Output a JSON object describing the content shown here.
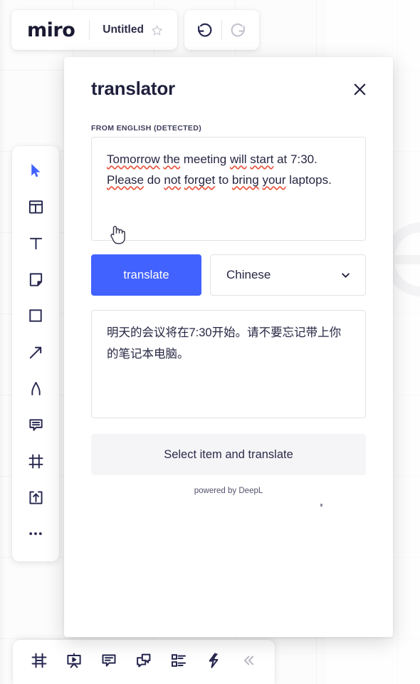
{
  "app": {
    "logo": "miro",
    "document_title": "Untitled",
    "star_icon": "star-icon",
    "undo_icon": "undo-arrow-icon",
    "redo_icon": "redo-arrow-icon"
  },
  "left_toolbar": {
    "items": [
      {
        "name": "select-cursor",
        "label": "Select",
        "icon": "cursor-arrow-icon",
        "active": true
      },
      {
        "name": "templates",
        "label": "Templates",
        "icon": "template-grid-icon",
        "active": false
      },
      {
        "name": "text",
        "label": "Text",
        "icon": "text-t-icon",
        "active": false
      },
      {
        "name": "sticky-note",
        "label": "Sticky note",
        "icon": "sticky-note-icon",
        "active": false
      },
      {
        "name": "shapes",
        "label": "Shapes",
        "icon": "square-shape-icon",
        "active": false
      },
      {
        "name": "connection-line",
        "label": "Connection line",
        "icon": "arrow-diagonal-icon",
        "active": false
      },
      {
        "name": "pen",
        "label": "Pen",
        "icon": "pen-compass-icon",
        "active": false
      },
      {
        "name": "comment",
        "label": "Comment",
        "icon": "comment-bubble-icon",
        "active": false
      },
      {
        "name": "frame",
        "label": "Frame",
        "icon": "frame-icon",
        "active": false
      },
      {
        "name": "upload",
        "label": "Upload",
        "icon": "upload-box-icon",
        "active": false
      },
      {
        "name": "more-apps",
        "label": "More apps",
        "icon": "ellipsis-icon",
        "active": false
      }
    ]
  },
  "bottom_toolbar": {
    "items": [
      {
        "name": "frames-panel",
        "label": "Frames",
        "icon": "frame-icon"
      },
      {
        "name": "presentation",
        "label": "Presentation mode",
        "icon": "presentation-play-icon"
      },
      {
        "name": "comments",
        "label": "Comments",
        "icon": "comment-lines-icon"
      },
      {
        "name": "chat",
        "label": "Chat",
        "icon": "chat-bubbles-icon"
      },
      {
        "name": "cards",
        "label": "Cards",
        "icon": "list-cards-icon"
      },
      {
        "name": "apps",
        "label": "Apps",
        "icon": "lightning-bolt-icon"
      },
      {
        "name": "collapse",
        "label": "Collapse",
        "icon": "double-chevron-left-icon"
      }
    ]
  },
  "panel": {
    "title": "translator",
    "close_icon": "close-x-icon",
    "source_label": "FROM ENGLISH (DETECTED)",
    "source_text": "Tomorrow the meeting will start at 7:30. Please do not forget to bring your laptops.",
    "source_spellcheck_words": [
      "Tomorrow",
      "the",
      "will",
      "start",
      "Please",
      "not",
      "forget",
      "bring",
      "your"
    ],
    "translate_button": "translate",
    "language_selected": "Chinese",
    "language_chevron_icon": "chevron-down-icon",
    "translated_text": "明天的会议将在7:30开始。请不要忘记带上你的笔记本电脑。",
    "select_item_button": "Select item and translate",
    "powered_by": "powered by DeepL"
  },
  "colors": {
    "accent": "#4262ff",
    "text_dark": "#1f1f3d",
    "panel_bg": "#ffffff",
    "muted_button_bg": "#f5f5f7",
    "spellcheck_red": "#e8553e",
    "border": "#e2e2e8"
  }
}
